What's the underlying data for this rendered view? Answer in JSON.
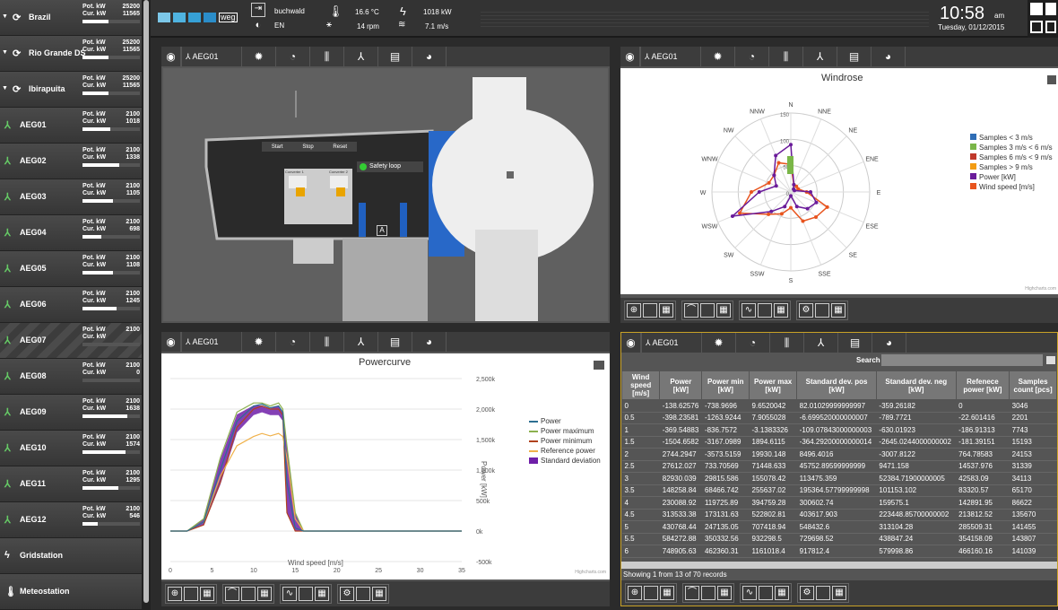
{
  "sidebar": {
    "groups": [
      {
        "label": "Brazil",
        "pot": "25200",
        "cur": "11565"
      },
      {
        "label": "Rio Grande DS",
        "pot": "25200",
        "cur": "11565"
      },
      {
        "label": "Ibirapuita",
        "pot": "25200",
        "cur": "11565"
      }
    ],
    "turbines": [
      {
        "label": "AEG01",
        "pot": "2100",
        "cur": "1018",
        "frac": 0.48
      },
      {
        "label": "AEG02",
        "pot": "2100",
        "cur": "1338",
        "frac": 0.64
      },
      {
        "label": "AEG03",
        "pot": "2100",
        "cur": "1105",
        "frac": 0.53
      },
      {
        "label": "AEG04",
        "pot": "2100",
        "cur": "698",
        "frac": 0.33
      },
      {
        "label": "AEG05",
        "pot": "2100",
        "cur": "1108",
        "frac": 0.53
      },
      {
        "label": "AEG06",
        "pot": "2100",
        "cur": "1245",
        "frac": 0.59
      },
      {
        "label": "AEG07",
        "pot": "2100",
        "cur": "",
        "frac": 0
      },
      {
        "label": "AEG08",
        "pot": "2100",
        "cur": "0",
        "frac": 0
      },
      {
        "label": "AEG09",
        "pot": "2100",
        "cur": "1638",
        "frac": 0.78
      },
      {
        "label": "AEG10",
        "pot": "2100",
        "cur": "1574",
        "frac": 0.75
      },
      {
        "label": "AEG11",
        "pot": "2100",
        "cur": "1295",
        "frac": 0.62
      },
      {
        "label": "AEG12",
        "pot": "2100",
        "cur": "546",
        "frac": 0.26
      }
    ],
    "extra": [
      "Gridstation",
      "Meteostation"
    ],
    "pot_label": "Pot. kW",
    "cur_label": "Cur. kW"
  },
  "topbar": {
    "user": "buchwald",
    "lang": "EN",
    "temp": "16.6 °C",
    "rpm": "14 rpm",
    "power": "1018 kW",
    "wind": "7.1 m/s",
    "time": "10:58",
    "ampm": "am",
    "date": "Tuesday, 01/12/2015",
    "brand": "weg"
  },
  "panels": {
    "turbine": "AEG01"
  },
  "nacelle": {
    "start": "Start",
    "stop": "Stop",
    "reset": "Reset",
    "safety": "Safety loop",
    "conv1": "Converter 1",
    "conv2": "Converter 2",
    "door": "A"
  },
  "windrose": {
    "title": "Windrose",
    "credit": "Highcharts.com",
    "directions": [
      "N",
      "NNE",
      "NE",
      "ENE",
      "E",
      "ESE",
      "SE",
      "SSE",
      "S",
      "SSW",
      "SW",
      "WSW",
      "W",
      "WNW",
      "NW",
      "NNW"
    ],
    "ticks": [
      "150",
      "100",
      "50",
      "0"
    ],
    "legend": [
      "Samples < 3 m/s",
      "Samples 3 m/s < 6 m/s",
      "Samples 6 m/s < 9 m/s",
      "Samples > 9 m/s",
      "Power [kW]",
      "Wind speed [m/s]"
    ],
    "colors": [
      "#2f6db5",
      "#7ab648",
      "#c0392b",
      "#f39c12",
      "#6a1b9a",
      "#e8541e"
    ]
  },
  "chart_data": {
    "type": "line",
    "title": "Powercurve",
    "credit": "Highcharts.com",
    "xlabel": "Wind speed [m/s]",
    "ylabel": "Power [kW]",
    "xlim": [
      0,
      35
    ],
    "ylim": [
      -500,
      2500
    ],
    "xticks": [
      "0",
      "5",
      "10",
      "15",
      "20",
      "25",
      "30",
      "35"
    ],
    "yticks": [
      "2,500k",
      "2,000k",
      "1,500k",
      "1,000k",
      "500k",
      "0k",
      "-500k"
    ],
    "series": [
      {
        "name": "Power",
        "color": "#2c6e91"
      },
      {
        "name": "Power maximum",
        "color": "#8bb04e"
      },
      {
        "name": "Power minimum",
        "color": "#b0421e"
      },
      {
        "name": "Reference power",
        "color": "#f0b14a"
      },
      {
        "name": "Standard deviation",
        "color": "#6f1fa8"
      }
    ]
  },
  "table": {
    "search": "Search",
    "footer": "Showing 1 from 13 of 70 records",
    "headers": [
      "Wind speed [m/s]",
      "Power [kW]",
      "Power min [kW]",
      "Power max [kW]",
      "Standard dev. pos [kW]",
      "Standard dev. neg [kW]",
      "Refenece power [kW]",
      "Samples count [pcs]"
    ],
    "rows": [
      [
        "0",
        "-138.62576",
        "-738.9696",
        "9.6520042",
        "82.01029999999997",
        "-359.26182",
        "0",
        "3046"
      ],
      [
        "0.5",
        "-398.23581",
        "-1263.9244",
        "7.9055028",
        "-6.699520000000007",
        "-789.7721",
        "-22.601416",
        "2201"
      ],
      [
        "1",
        "-369.54883",
        "-836.7572",
        "-3.1383326",
        "-109.07843000000003",
        "-630.01923",
        "-186.91313",
        "7743"
      ],
      [
        "1.5",
        "-1504.6582",
        "-3167.0989",
        "1894.6115",
        "-364.29200000000014",
        "-2645.0244000000002",
        "-181.39151",
        "15193"
      ],
      [
        "2",
        "2744.2947",
        "-3573.5159",
        "19930.148",
        "8496.4016",
        "-3007.8122",
        "764.78583",
        "24153"
      ],
      [
        "2.5",
        "27612.027",
        "733.70569",
        "71448.633",
        "45752.89599999999",
        "9471.158",
        "14537.976",
        "31339"
      ],
      [
        "3",
        "82930.039",
        "29815.586",
        "155078.42",
        "113475.359",
        "52384.71900000005",
        "42583.09",
        "34113"
      ],
      [
        "3.5",
        "148258.84",
        "68466.742",
        "255637.02",
        "195364.57799999998",
        "101153.102",
        "83320.57",
        "65170"
      ],
      [
        "4",
        "230088.92",
        "119725.89",
        "394759.28",
        "300602.74",
        "159575.1",
        "142891.95",
        "86622"
      ],
      [
        "4.5",
        "313533.38",
        "173131.63",
        "522802.81",
        "403617.903",
        "223448.85700000002",
        "213812.52",
        "135670"
      ],
      [
        "5",
        "430768.44",
        "247135.05",
        "707418.94",
        "548432.6",
        "313104.28",
        "285509.31",
        "141455"
      ],
      [
        "5.5",
        "584272.88",
        "350332.56",
        "932298.5",
        "729698.52",
        "438847.24",
        "354158.09",
        "143807"
      ],
      [
        "6",
        "748905.63",
        "462360.31",
        "1161018.4",
        "917812.4",
        "579998.86",
        "466160.16",
        "141039"
      ]
    ]
  }
}
